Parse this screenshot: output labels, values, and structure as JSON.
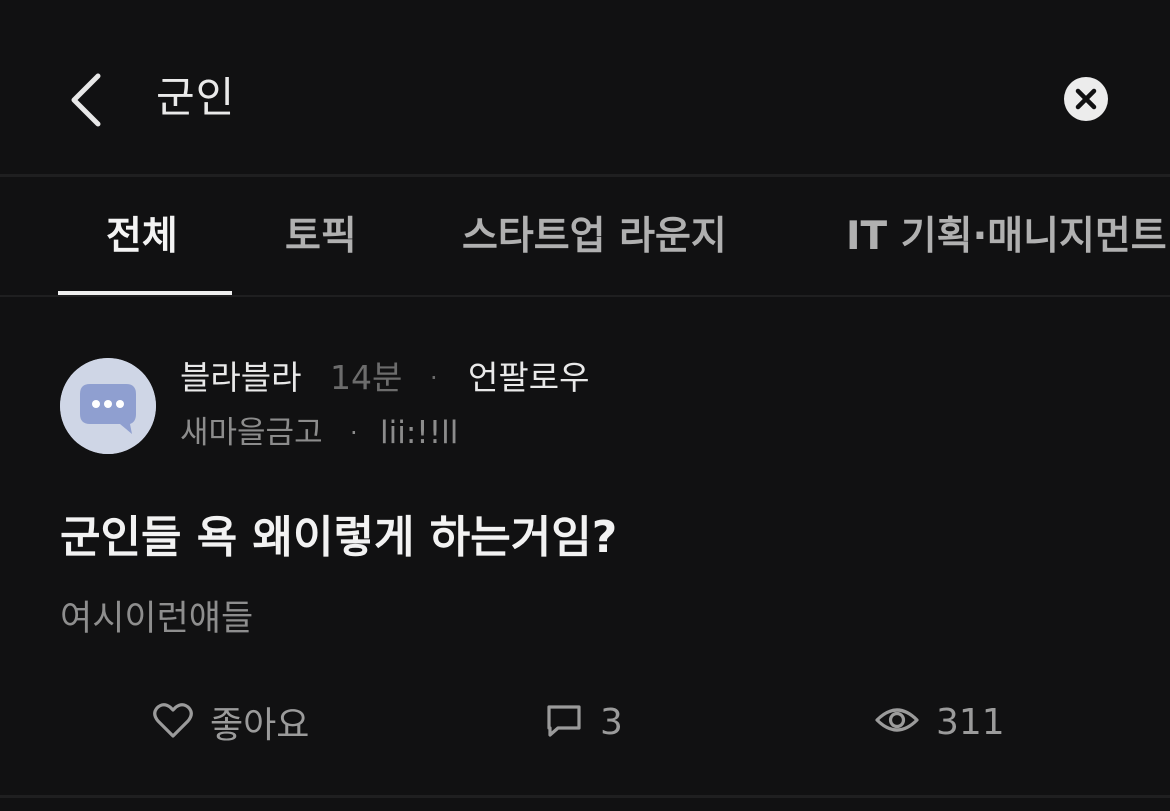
{
  "header": {
    "search_query": "군인",
    "back_icon": "chevron-left-icon",
    "clear_icon": "close-circle-icon"
  },
  "tabs": [
    {
      "label": "전체",
      "active": true
    },
    {
      "label": "토픽",
      "active": false
    },
    {
      "label": "스타트업 라운지",
      "active": false
    },
    {
      "label": "IT 기획·매니지먼트",
      "active": false
    }
  ],
  "post": {
    "avatar_icon": "chat-bubble-icon",
    "author": "블라블라",
    "time": "14분",
    "separator": "·",
    "company": "언팔로우",
    "meta": "새마을금고",
    "meta_separator": "·",
    "meta_tag": "lii:!!ll",
    "title": "군인들 욕 왜이렇게 하는거임?",
    "body": "여시이런얘들",
    "actions": {
      "like_icon": "heart-icon",
      "like_label": "좋아요",
      "comment_icon": "comment-icon",
      "comment_count": "3",
      "view_icon": "eye-icon",
      "view_count": "311"
    }
  },
  "colors": {
    "background": "#111112",
    "divider": "#1f1f20",
    "primary_text": "#e9e9e9",
    "muted_text": "#8c8c8c",
    "avatar_bg": "#cfd6e6",
    "avatar_bubble": "#8f9fd0"
  }
}
